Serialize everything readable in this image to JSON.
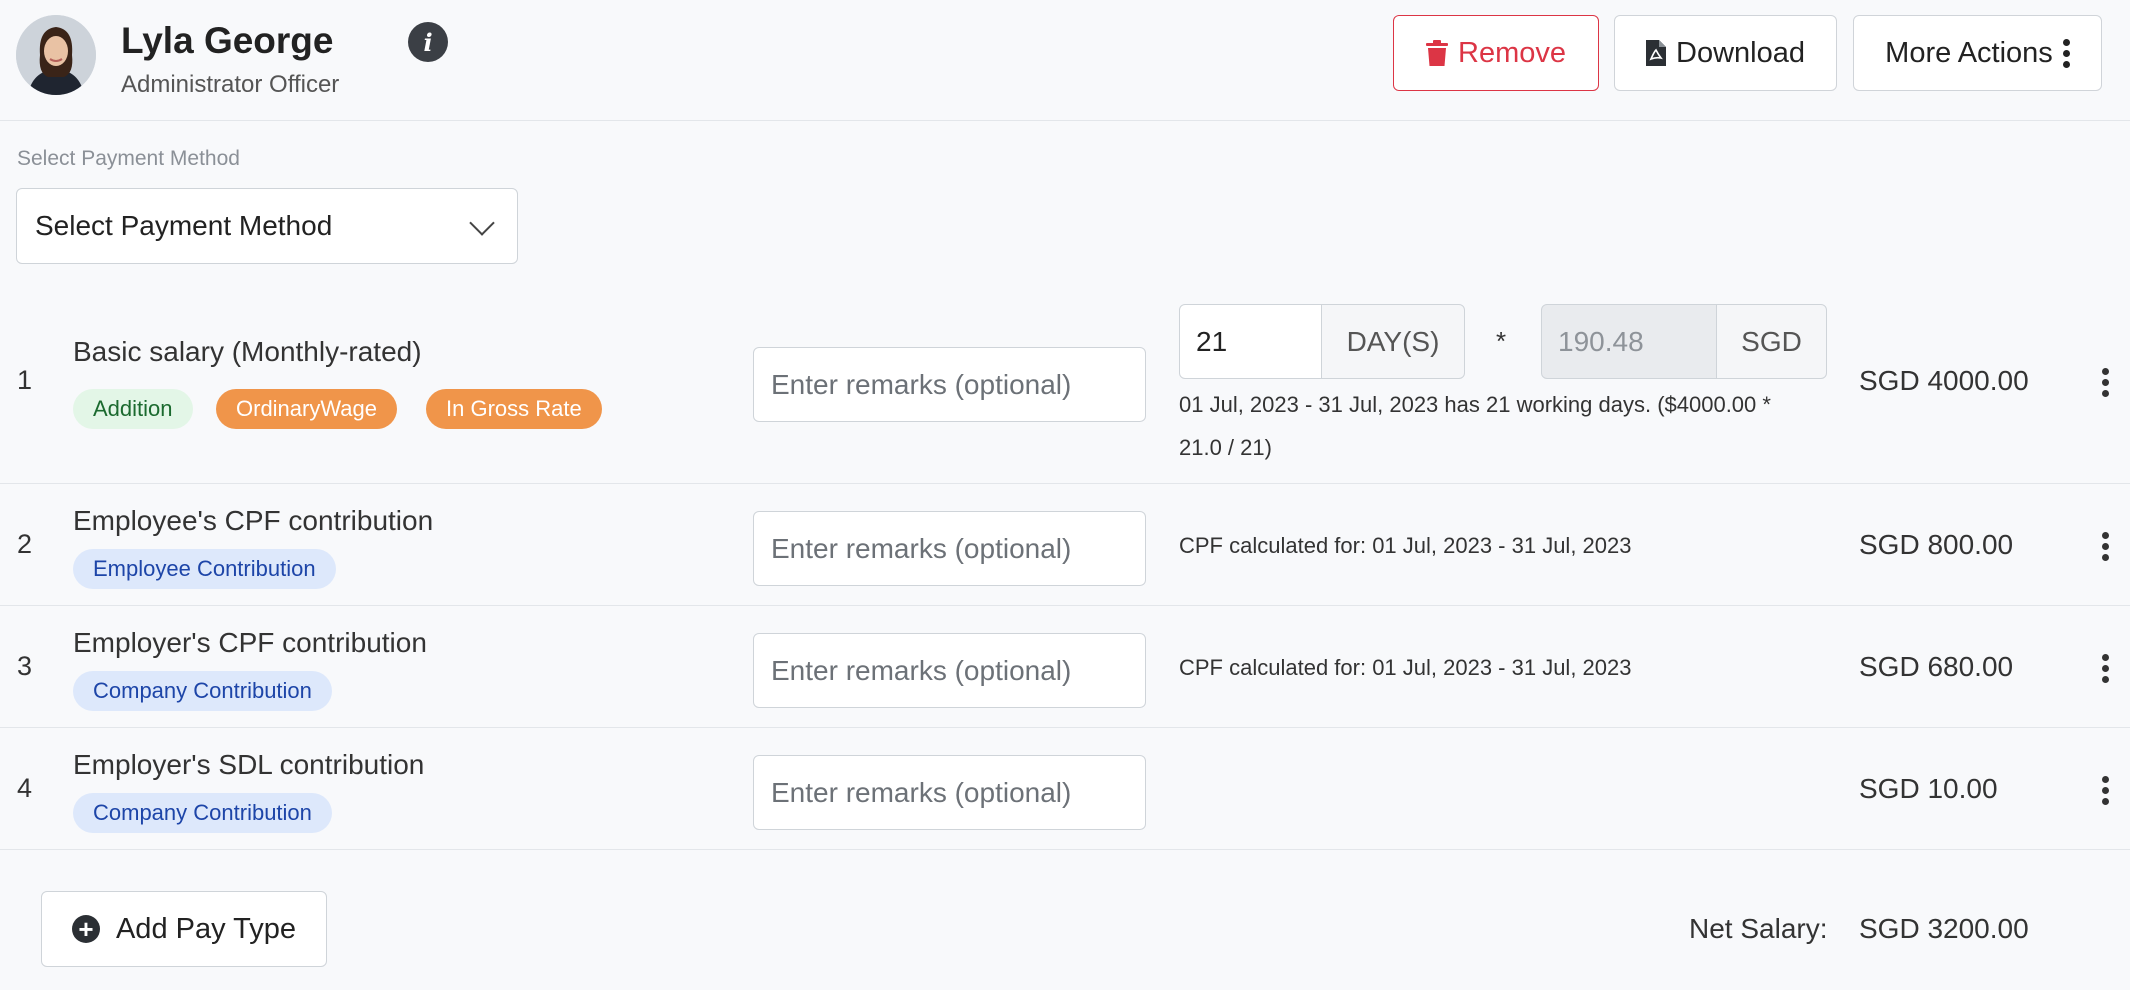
{
  "employee": {
    "name": "Lyla George",
    "role": "Administrator Officer"
  },
  "toolbar": {
    "remove_label": "Remove",
    "download_label": "Download",
    "more_label": "More Actions"
  },
  "payment_method": {
    "label": "Select Payment Method",
    "selected": "Select Payment Method"
  },
  "remarks_placeholder": "Enter remarks (optional)",
  "rows": [
    {
      "num": "1",
      "title": "Basic salary (Monthly-rated)",
      "badges": [
        "Addition",
        "OrdinaryWage",
        "In Gross Rate"
      ],
      "days_value": "21",
      "days_unit": "DAY(S)",
      "times": "*",
      "rate_placeholder": "190.48",
      "rate_unit": "SGD",
      "description": "01 Jul, 2023 - 31 Jul, 2023 has 21 working days. ($4000.00 * 21.0 / 21)",
      "amount": "SGD 4000.00"
    },
    {
      "num": "2",
      "title": "Employee's CPF contribution",
      "badges": [
        "Employee Contribution"
      ],
      "description": "CPF calculated for: 01 Jul, 2023 - 31 Jul, 2023",
      "amount": "SGD 800.00"
    },
    {
      "num": "3",
      "title": "Employer's CPF contribution",
      "badges": [
        "Company Contribution"
      ],
      "description": "CPF calculated for: 01 Jul, 2023 - 31 Jul, 2023",
      "amount": "SGD 680.00"
    },
    {
      "num": "4",
      "title": "Employer's SDL contribution",
      "badges": [
        "Company Contribution"
      ],
      "description": "",
      "amount": "SGD 10.00"
    }
  ],
  "footer": {
    "add_label": "Add Pay Type",
    "net_label": "Net Salary:",
    "net_value": "SGD 3200.00"
  },
  "colors": {
    "danger": "#dc3545",
    "orange_badge": "#f0954a",
    "green_badge_bg": "#e3f6e7",
    "blue_badge_bg": "#dde8fb"
  }
}
